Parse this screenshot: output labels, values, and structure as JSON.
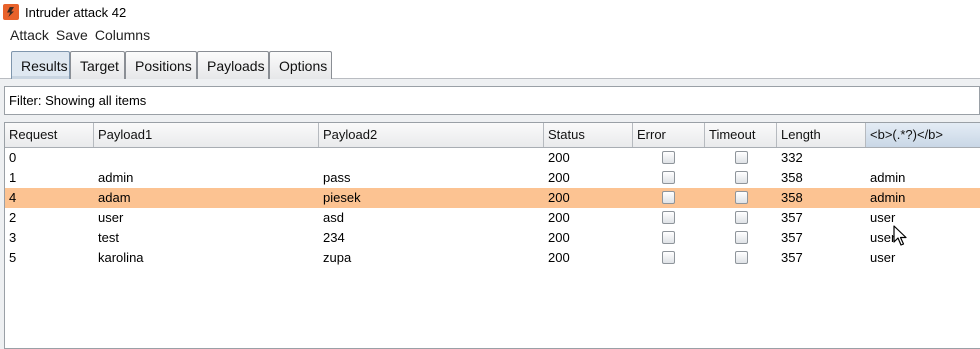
{
  "window": {
    "title": "Intruder attack 42"
  },
  "menu": [
    "Attack",
    "Save",
    "Columns"
  ],
  "tabs": [
    "Results",
    "Target",
    "Positions",
    "Payloads",
    "Options"
  ],
  "active_tab": "Results",
  "filter": {
    "text": "Filter: Showing all items"
  },
  "table": {
    "columns": [
      "Request",
      "Payload1",
      "Payload2",
      "Status",
      "Error",
      "Timeout",
      "Length",
      "<b>(.*?)</b>"
    ],
    "rows": [
      {
        "request": "0",
        "payload1": "",
        "payload2": "",
        "status": "200",
        "error": false,
        "timeout": false,
        "length": "332",
        "extract": "",
        "highlighted": false
      },
      {
        "request": "1",
        "payload1": "admin",
        "payload2": "pass",
        "status": "200",
        "error": false,
        "timeout": false,
        "length": "358",
        "extract": "admin",
        "highlighted": false
      },
      {
        "request": "4",
        "payload1": "adam",
        "payload2": "piesek",
        "status": "200",
        "error": false,
        "timeout": false,
        "length": "358",
        "extract": "admin",
        "highlighted": true
      },
      {
        "request": "2",
        "payload1": "user",
        "payload2": "asd",
        "status": "200",
        "error": false,
        "timeout": false,
        "length": "357",
        "extract": "user",
        "highlighted": false
      },
      {
        "request": "3",
        "payload1": "test",
        "payload2": "234",
        "status": "200",
        "error": false,
        "timeout": false,
        "length": "357",
        "extract": "user",
        "highlighted": false
      },
      {
        "request": "5",
        "payload1": "karolina",
        "payload2": "zupa",
        "status": "200",
        "error": false,
        "timeout": false,
        "length": "357",
        "extract": "user",
        "highlighted": false
      }
    ]
  },
  "colors": {
    "highlight_row": "#fcc392",
    "active_tab": "#dfe8f1"
  }
}
